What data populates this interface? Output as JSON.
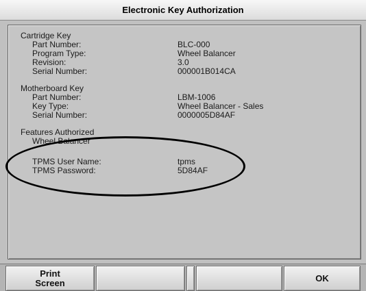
{
  "window": {
    "title": "Electronic Key Authorization"
  },
  "cartridge_key": {
    "heading": "Cartridge Key",
    "rows": [
      {
        "label": "Part Number:",
        "value": "BLC-000"
      },
      {
        "label": "Program Type:",
        "value": "Wheel Balancer"
      },
      {
        "label": "Revision:",
        "value": "3.0"
      },
      {
        "label": "Serial Number:",
        "value": "000001B014CA"
      }
    ]
  },
  "motherboard_key": {
    "heading": "Motherboard Key",
    "rows": [
      {
        "label": "Part Number:",
        "value": "LBM-1006"
      },
      {
        "label": "Key Type:",
        "value": "Wheel Balancer - Sales"
      },
      {
        "label": "Serial Number:",
        "value": "0000005D84AF"
      }
    ]
  },
  "features": {
    "heading": "Features Authorized",
    "items": [
      "Wheel Balancer"
    ],
    "tpms": [
      {
        "label": "TPMS User Name:",
        "value": "tpms"
      },
      {
        "label": "TPMS Password:",
        "value": "5D84AF"
      }
    ]
  },
  "softkeys": {
    "key1_line1": "Print",
    "key1_line2": "Screen",
    "key2": "",
    "key3": "",
    "key4": "",
    "key5": "OK"
  }
}
